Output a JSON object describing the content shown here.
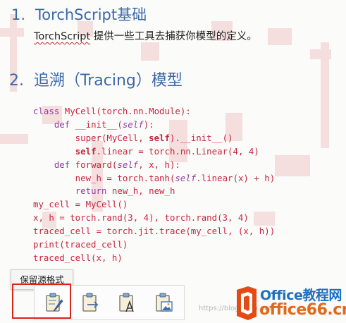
{
  "sections": [
    {
      "number": "1.",
      "title": "TorchScript基础"
    },
    {
      "number": "2.",
      "title": "追溯（Tracing）模型"
    }
  ],
  "paragraph": {
    "term": "TorchScript",
    "text": " 提供一些工具去捕获你模型的定义。"
  },
  "code_lines": [
    "class MyCell(torch.nn.Module):",
    "    def __init__(self):",
    "        super(MyCell, self).__init__()",
    "        self.linear = torch.nn.Linear(4, 4)",
    "    def forward(self, x, h):",
    "        new_h = torch.tanh(self.linear(x) + h)",
    "        return new_h, new_h",
    "my_cell = MyCell()",
    "x, h = torch.rand(3, 4), torch.rand(3, 4)",
    "traced_cell = torch.jit.trace(my_cell, (x, h))",
    "print(traced_cell)",
    "traced_cell(x, h)"
  ],
  "paste_options": {
    "tooltip": "保留源格式",
    "buttons": [
      {
        "name": "keep-source-formatting",
        "icon": "paste-brush-icon"
      },
      {
        "name": "merge-formatting",
        "icon": "paste-arrow-icon"
      },
      {
        "name": "keep-text-only",
        "icon": "paste-text-icon"
      },
      {
        "name": "paste-as-picture",
        "icon": "paste-picture-icon"
      }
    ]
  },
  "watermark": {
    "site": "https://blog.csdn.net/",
    "logo_line1": "Office教程网",
    "logo_line2": "office66.cn"
  },
  "colors": {
    "heading": "#3a68a8",
    "code_text": "#c7253e",
    "code_keyword": "#8f3e9c",
    "highlight": "#d7261c"
  }
}
